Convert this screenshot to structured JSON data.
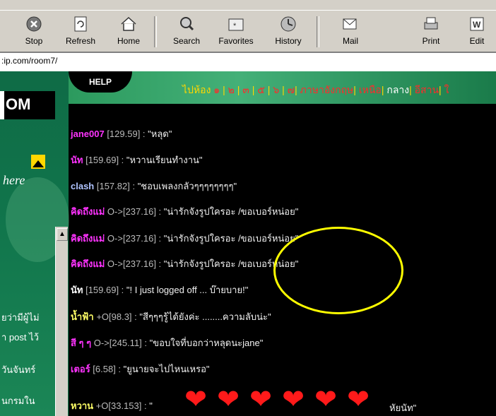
{
  "toolbar": {
    "items": [
      {
        "label": "Stop",
        "icon": "stop-icon"
      },
      {
        "label": "Refresh",
        "icon": "refresh-icon"
      },
      {
        "label": "Home",
        "icon": "home-icon"
      },
      {
        "label": "Search",
        "icon": "search-icon"
      },
      {
        "label": "Favorites",
        "icon": "favorites-icon"
      },
      {
        "label": "History",
        "icon": "history-icon"
      },
      {
        "label": "Mail",
        "icon": "mail-icon"
      },
      {
        "label": "Print",
        "icon": "print-icon"
      },
      {
        "label": "Edit",
        "icon": "edit-icon"
      }
    ]
  },
  "address": {
    "value": ":ip.com/room7/"
  },
  "sidebar": {
    "logo": "OM",
    "here": "here",
    "lines": [
      "ยว่ามีผู้ไม่",
      "า post ไว้",
      "วันจันทร์",
      "นกรมใน"
    ]
  },
  "help": "HELP",
  "nav": {
    "prefix": "ไปห้อง",
    "rooms": [
      "๑",
      "๒",
      "๓",
      "๕",
      "๖",
      "๗"
    ],
    "links": [
      "ภาษาอังกฤษ",
      "เหนือ",
      "กลาง",
      "อีสาน",
      "ใ"
    ]
  },
  "chat": [
    {
      "nick": "jane007",
      "nick_color": "#ff33ff",
      "ip": " [129.59] : ",
      "msg": "\"หลุด\""
    },
    {
      "nick": "นัท",
      "nick_color": "#ff33ff",
      "ip": " [159.69] : ",
      "msg": "\"หวานเรียนทำงาน\""
    },
    {
      "nick": "clash",
      "nick_color": "#b0c4ff",
      "ip": " [157.82] : ",
      "msg": "\"ชอบเพลงกลัวๆๆๆๆๆๆๆๆ\""
    },
    {
      "nick": "คิดถึงแม่",
      "nick_color": "#ff33ff",
      "ip": " O->[237.16] : ",
      "msg": "\"น่ารักจังรูปใครอะ /ขอเบอร์หน่อย\""
    },
    {
      "nick": "คิดถึงแม่",
      "nick_color": "#ff33ff",
      "ip": " O->[237.16] : ",
      "msg": "\"น่ารักจังรูปใครอะ /ขอเบอร์หน่อย\""
    },
    {
      "nick": "คิดถึงแม่",
      "nick_color": "#ff33ff",
      "ip": " O->[237.16] : ",
      "msg": "\"น่ารักจังรูปใครอะ /ขอเบอร์หน่อย\""
    },
    {
      "nick": "นัท",
      "nick_color": "#ffffff",
      "ip": " [159.69] : ",
      "msg": "\"! I just logged off ... บ๊ายบาย!\""
    },
    {
      "nick": "น้ำฟ้า",
      "nick_color": "#ffff66",
      "ip": " +O[98.3] : ",
      "msg": "\"สีๆๆๆรู้ได้ยังค่ะ ........ความลับน่ะ\""
    },
    {
      "nick": "สี ๆ ๆ",
      "nick_color": "#ff33ff",
      "ip": " O->[245.11] : ",
      "msg": "\"ขอบใจที่บอกว่าหลุดนะjane\""
    },
    {
      "nick": "เตอร์",
      "nick_color": "#ff33ff",
      "ip": " [6.58] : ",
      "msg": "\"ยูนายจะไปไหนเหรอ\""
    },
    {
      "nick": "หวาน",
      "nick_color": "#ffff66",
      "ip": " +O[33.153] : ",
      "msg": "\""
    }
  ],
  "last_msg_tail": "หัยนัท\"",
  "hearts": [
    "❤",
    "❤",
    "❤",
    "❤",
    "❤",
    "❤"
  ],
  "colors": {
    "circle": "#ffff00",
    "nav": "#ffd700",
    "room_num": "#ff2a2a"
  }
}
